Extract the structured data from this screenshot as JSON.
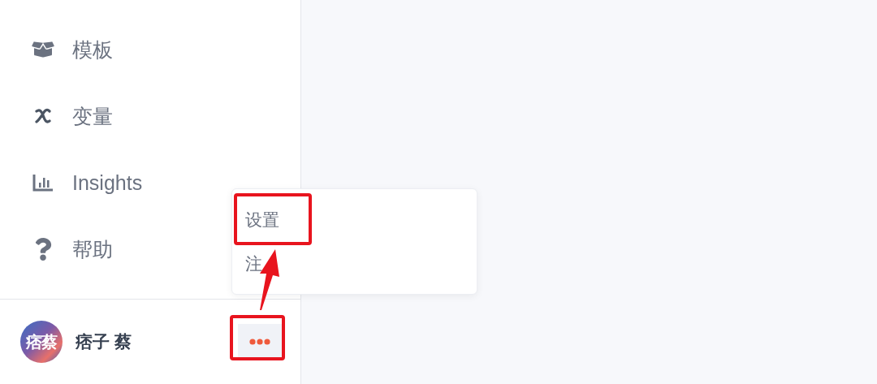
{
  "sidebar": {
    "items": [
      {
        "kind": "box",
        "label": "模板"
      },
      {
        "kind": "variable",
        "label": "变量"
      },
      {
        "kind": "chart",
        "label": "Insights"
      },
      {
        "kind": "help",
        "label": "帮助"
      }
    ]
  },
  "user": {
    "avatar_text": "痞蔡",
    "name": "痞子 蔡"
  },
  "menu": {
    "open": true,
    "items": [
      {
        "label": "设置",
        "highlighted": true
      },
      {
        "label": "注",
        "highlighted": false
      }
    ]
  },
  "more_button": {
    "highlighted": true
  }
}
